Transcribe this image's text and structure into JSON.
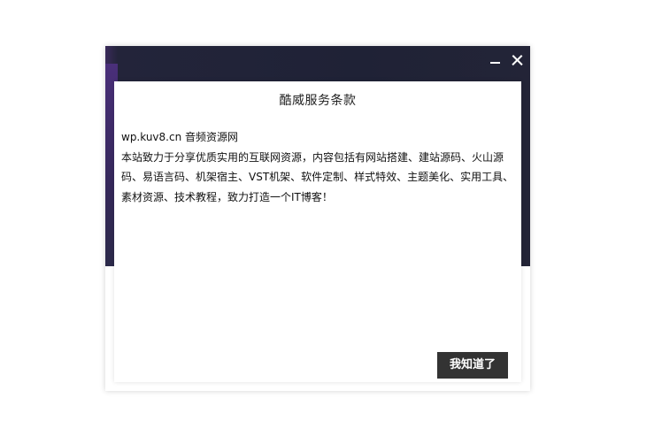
{
  "dialog": {
    "title": "酷威服务条款",
    "site_line": "wp.kuv8.cn 音频资源网",
    "description": "本站致力于分享优质实用的互联网资源，内容包括有网站搭建、建站源码、火山源码、易语言码、机架宿主、VST机架、软件定制、样式特效、主题美化、实用工具、素材资源、技术教程，致力打造一个IT博客！",
    "confirm_label": "我知道了"
  },
  "window_controls": {
    "minimize_icon": "minimize-icon",
    "close_icon": "close-icon"
  },
  "colors": {
    "banner": "#1f2236",
    "banner_accent": "#4a2f7a",
    "button": "#333333",
    "button_text": "#ffffff",
    "text": "#111111"
  }
}
